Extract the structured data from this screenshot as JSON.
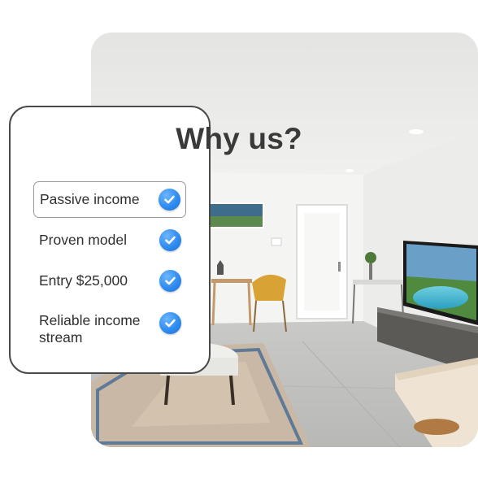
{
  "card": {
    "title": "Why us?",
    "features": [
      {
        "label": "Passive income",
        "selected": true
      },
      {
        "label": "Proven model",
        "selected": false
      },
      {
        "label": "Entry $25,000",
        "selected": false
      },
      {
        "label": "Reliable income stream",
        "selected": false
      }
    ]
  },
  "colors": {
    "check_blue": "#2f8cf0",
    "title_text": "#3a3a3a",
    "card_border": "#4a4a4a"
  },
  "icons": [
    "check-circle-icon"
  ]
}
